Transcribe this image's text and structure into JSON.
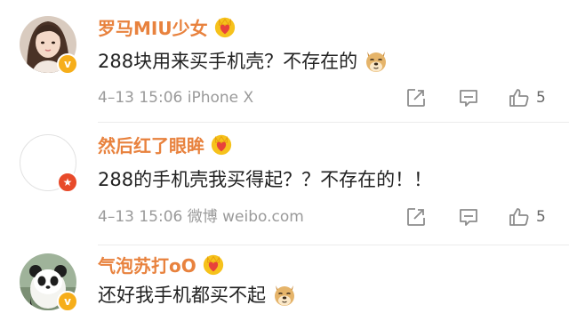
{
  "comments": [
    {
      "username": "罗马MIU少女",
      "text": "288块用来买手机壳？不存在的",
      "timestamp": "4–13 15:06",
      "source": "iPhone X",
      "like_count": "5",
      "verified_badge": "gold",
      "emoji": "doge-emoji"
    },
    {
      "username": "然后红了眼眸",
      "text": "288的手机壳我买得起？？不存在的！！",
      "timestamp": "4–13 15:06",
      "source": "微博 weibo.com",
      "like_count": "5",
      "verified_badge": "red",
      "emoji": ""
    },
    {
      "username": "气泡苏打oO",
      "text": "还好我手机都买不起",
      "verified_badge": "gold",
      "emoji": "doge-emoji"
    }
  ],
  "colors": {
    "username": "#e8823e",
    "body_text": "#222222",
    "meta_text": "#9a9a9a",
    "icon_gray": "#8c8c8c",
    "gold_badge": "#f6ae1a",
    "red_badge": "#e84a2a"
  },
  "icons": [
    "crown-heart-icon",
    "repost-icon",
    "reply-icon",
    "like-icon",
    "doge-emoji",
    "verified-badge-icon"
  ]
}
